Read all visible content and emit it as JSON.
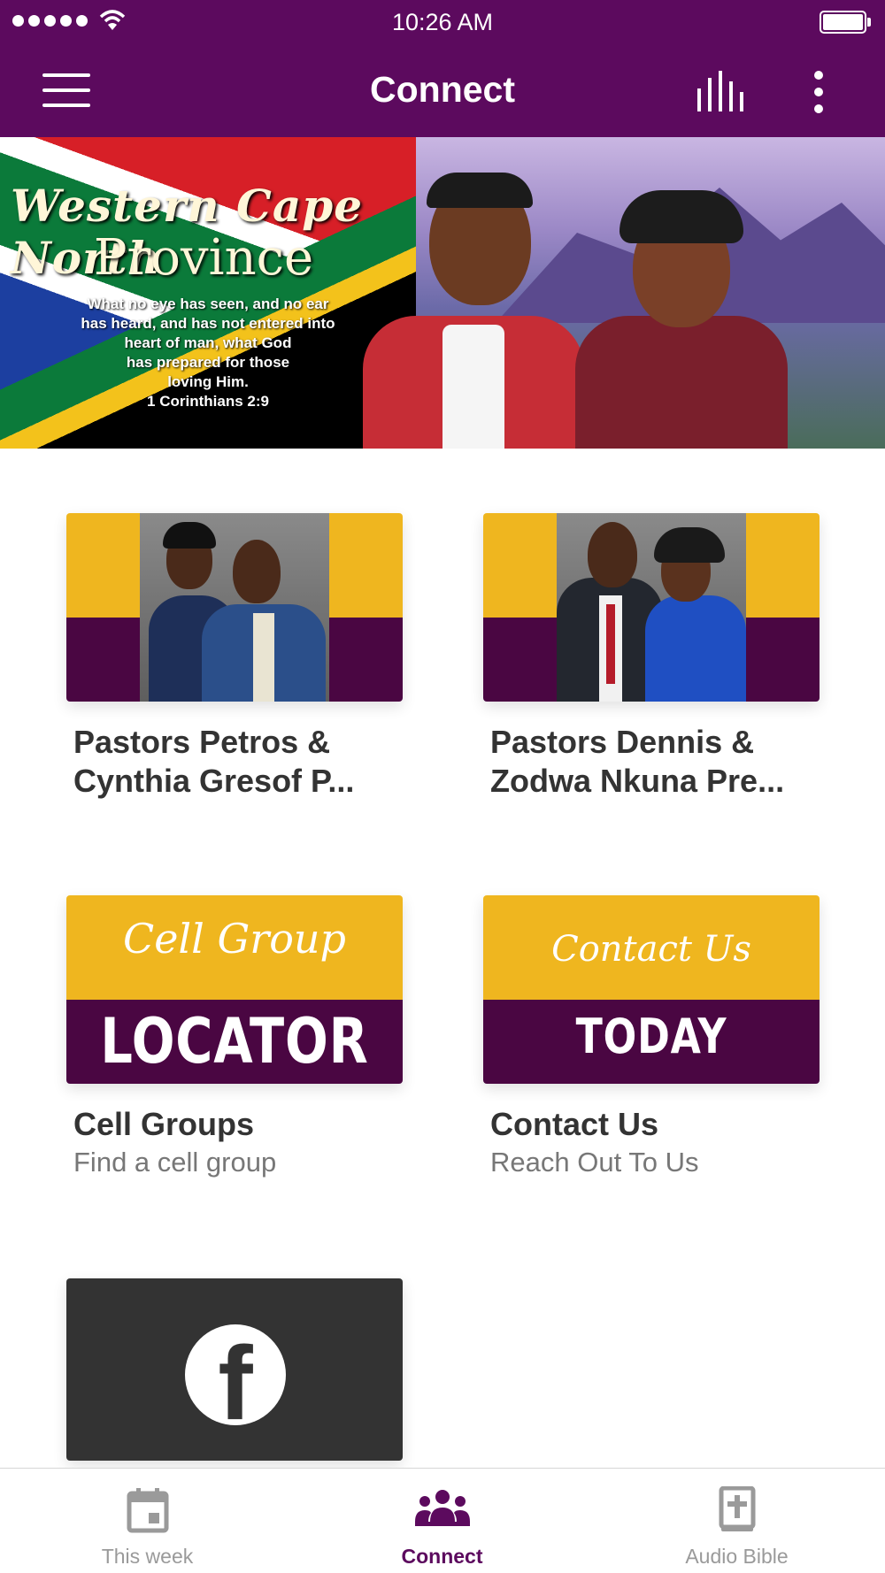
{
  "status_bar": {
    "time": "10:26 AM"
  },
  "header": {
    "title": "Connect"
  },
  "banner": {
    "script_title": "Western Cape North",
    "title": "Province",
    "verse": "What no eye has seen, and no ear\nhas heard, and has not entered into\nheart of man, what God\nhas prepared for those\nloving Him.\n1 Corinthians 2:9"
  },
  "cards": [
    {
      "title": "Pastors Petros & Cynthia Gresof  P...",
      "subtitle": ""
    },
    {
      "title": "Pastors Dennis & Zodwa Nkuna Pre...",
      "subtitle": ""
    },
    {
      "title": "Cell Groups",
      "subtitle": "Find a cell group",
      "thumb_script": "Cell Group",
      "thumb_block": "LOCATOR"
    },
    {
      "title": "Contact Us",
      "subtitle": "Reach Out To Us",
      "thumb_script": "Contact Us",
      "thumb_block": "TODAY"
    },
    {
      "title": "",
      "subtitle": "",
      "thumb_icon": "facebook-icon"
    }
  ],
  "tabs": [
    {
      "label": "This week",
      "icon": "calendar-icon",
      "active": false
    },
    {
      "label": "Connect",
      "icon": "people-group-icon",
      "active": true
    },
    {
      "label": "Audio Bible",
      "icon": "bible-icon",
      "active": false
    }
  ],
  "colors": {
    "brand_purple": "#5c0a5e",
    "thumb_gold": "#efb61f",
    "thumb_plum": "#4a0642",
    "tab_inactive": "#9a9a9a"
  }
}
